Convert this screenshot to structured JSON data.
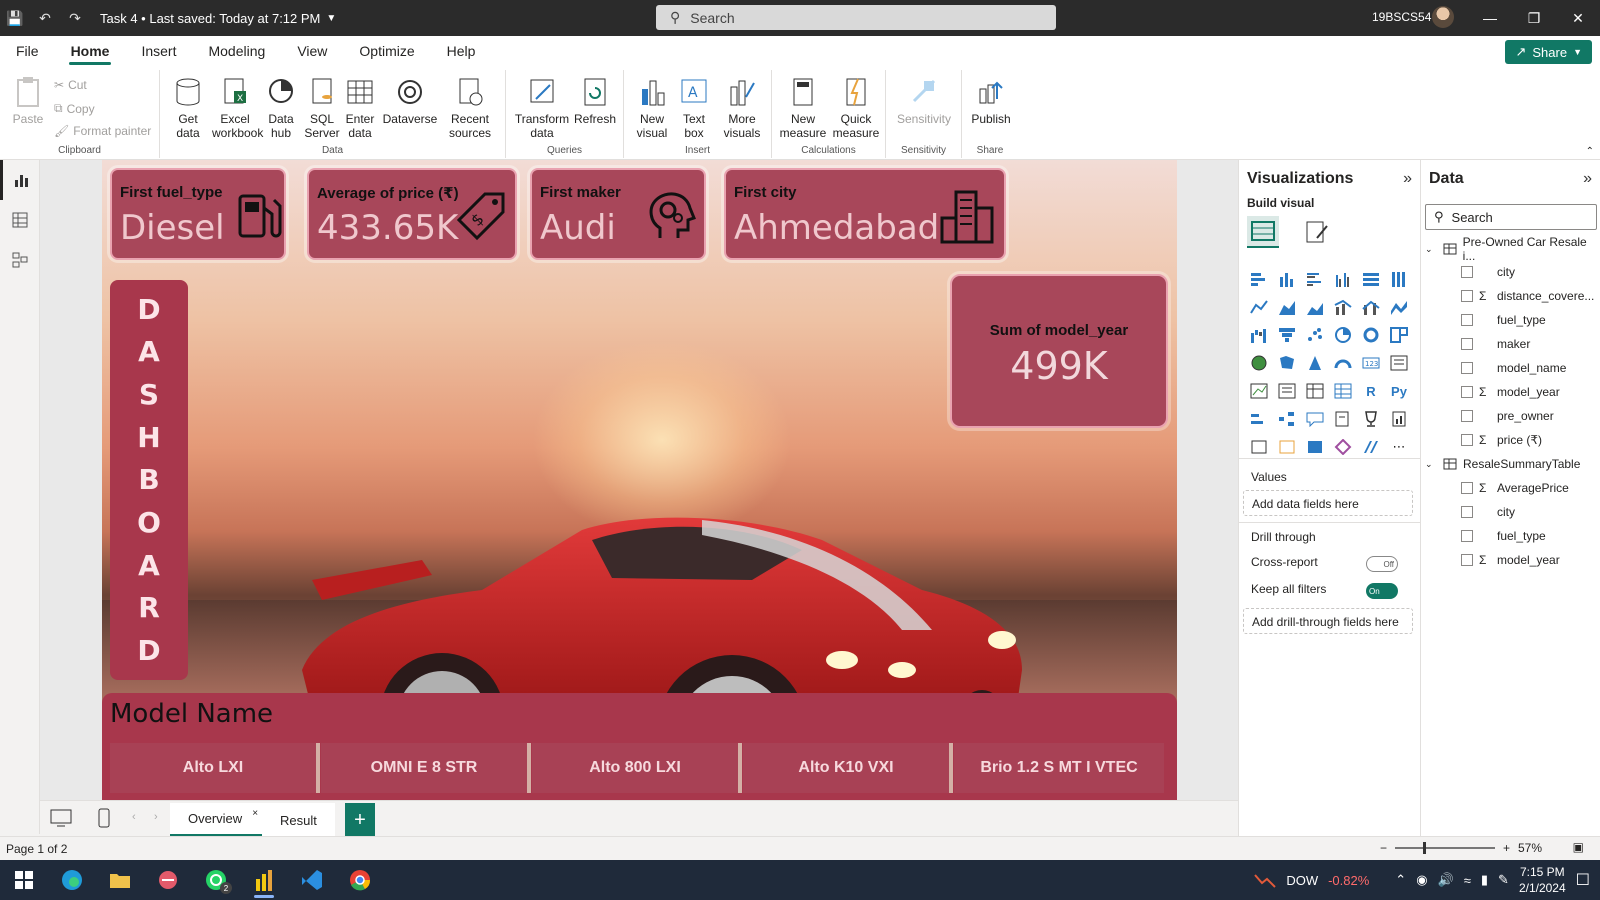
{
  "titlebar": {
    "title": "Task 4 • Last saved: Today at 7:12 PM",
    "search_placeholder": "Search",
    "user": "19BSCS54"
  },
  "menu": {
    "items": [
      "File",
      "Home",
      "Insert",
      "Modeling",
      "View",
      "Optimize",
      "Help"
    ],
    "active": "Home",
    "share_label": "Share"
  },
  "ribbon": {
    "clipboard": {
      "paste": "Paste",
      "cut": "Cut",
      "copy": "Copy",
      "format_painter": "Format painter",
      "group": "Clipboard"
    },
    "data": {
      "get_data": "Get data",
      "excel": "Excel workbook",
      "data_hub": "Data hub",
      "sql": "SQL Server",
      "enter_data": "Enter data",
      "dataverse": "Dataverse",
      "recent": "Recent sources",
      "group": "Data"
    },
    "queries": {
      "transform": "Transform data",
      "refresh": "Refresh",
      "group": "Queries"
    },
    "insert": {
      "new_visual": "New visual",
      "text_box": "Text box",
      "more_visuals": "More visuals",
      "group": "Insert"
    },
    "calculations": {
      "new_measure": "New measure",
      "quick_measure": "Quick measure",
      "group": "Calculations"
    },
    "sensitivity": {
      "sensitivity": "Sensitivity",
      "group": "Sensitivity"
    },
    "share": {
      "publish": "Publish",
      "group": "Share"
    }
  },
  "cards": [
    {
      "label": "First fuel_type",
      "value": "Diesel",
      "icon": "fuel-pump-icon"
    },
    {
      "label": "Average of price (₹)",
      "value": "433.65K",
      "icon": "price-tag-icon"
    },
    {
      "label": "First maker",
      "value": "Audi",
      "icon": "maker-head-gears-icon"
    },
    {
      "label": "First city",
      "value": "Ahmedabad",
      "icon": "city-buildings-icon"
    }
  ],
  "side_title": [
    "D",
    "A",
    "S",
    "H",
    "B",
    "O",
    "A",
    "R",
    "D"
  ],
  "big_card": {
    "label": "Sum of model_year",
    "value": "499K"
  },
  "slicer": {
    "title": "Model Name",
    "items": [
      "Alto LXI",
      "OMNI E 8 STR",
      "Alto 800 LXI",
      "Alto K10 VXI",
      "Brio 1.2 S MT I VTEC"
    ]
  },
  "page_tabs": {
    "tabs": [
      "Overview",
      "Result"
    ],
    "active": "Overview"
  },
  "status": {
    "page": "Page 1 of 2",
    "zoom": "57%"
  },
  "visualizations": {
    "title": "Visualizations",
    "build_visual": "Build visual",
    "values_label": "Values",
    "values_placeholder": "Add data fields here",
    "drill_through": "Drill through",
    "cross_report": "Cross-report",
    "cross_report_state": "Off",
    "keep_filters": "Keep all filters",
    "keep_filters_state": "On",
    "drill_placeholder": "Add drill-through fields here"
  },
  "data_pane": {
    "title": "Data",
    "search_placeholder": "Search",
    "tables": [
      {
        "name": "Pre-Owned Car Resale i...",
        "fields": [
          {
            "name": "city",
            "sum": false
          },
          {
            "name": "distance_covere...",
            "sum": true
          },
          {
            "name": "fuel_type",
            "sum": false
          },
          {
            "name": "maker",
            "sum": false
          },
          {
            "name": "model_name",
            "sum": false
          },
          {
            "name": "model_year",
            "sum": true
          },
          {
            "name": "pre_owner",
            "sum": false
          },
          {
            "name": "price (₹)",
            "sum": true
          }
        ]
      },
      {
        "name": "ResaleSummaryTable",
        "fields": [
          {
            "name": "AveragePrice",
            "sum": true
          },
          {
            "name": "city",
            "sum": false
          },
          {
            "name": "fuel_type",
            "sum": false
          },
          {
            "name": "model_year",
            "sum": true
          }
        ]
      }
    ]
  },
  "taskbar": {
    "stock_name": "DOW",
    "stock_change": "-0.82%",
    "time": "7:15 PM",
    "date": "2/1/2024",
    "whatsapp_badge": "2"
  },
  "colors": {
    "accent": "#117865",
    "card": "#a8475a",
    "side": "#a8374c"
  }
}
